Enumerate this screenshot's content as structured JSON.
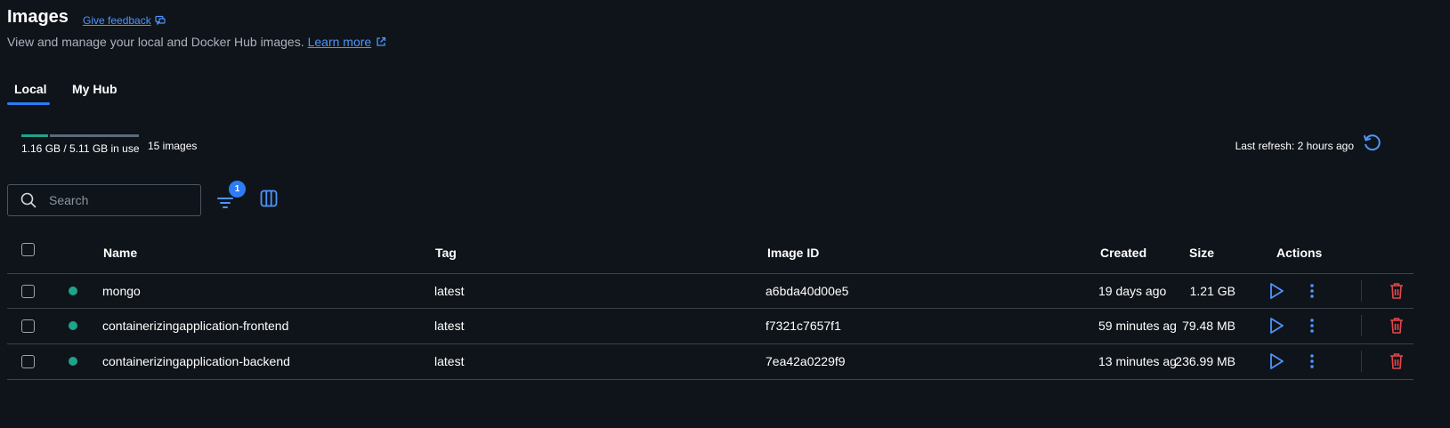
{
  "header": {
    "title": "Images",
    "feedback_label": "Give feedback",
    "subtitle": "View and manage your local and Docker Hub images.",
    "learn_more": "Learn more"
  },
  "tabs": [
    {
      "label": "Local",
      "active": true
    },
    {
      "label": "My Hub",
      "active": false
    }
  ],
  "usage": {
    "text": "1.16 GB / 5.11 GB in use",
    "used_fraction": 0.227,
    "count_text": "15 images",
    "refresh_text": "Last refresh: 2 hours ago"
  },
  "search": {
    "placeholder": "Search",
    "value": ""
  },
  "filter": {
    "badge": "1"
  },
  "table": {
    "headers": {
      "name": "Name",
      "tag": "Tag",
      "image_id": "Image ID",
      "created": "Created",
      "size": "Size",
      "actions": "Actions"
    },
    "rows": [
      {
        "name": "mongo",
        "tag": "latest",
        "image_id": "a6bda40d00e5",
        "created": "19 days ago",
        "size": "1.21 GB"
      },
      {
        "name": "containerizingapplication-frontend",
        "tag": "latest",
        "image_id": "f7321c7657f1",
        "created": "59 minutes ag",
        "size": "79.48 MB"
      },
      {
        "name": "containerizingapplication-backend",
        "tag": "latest",
        "image_id": "7ea42a0229f9",
        "created": "13 minutes ag",
        "size": "236.99 MB"
      }
    ]
  },
  "colors": {
    "accent": "#2d7cf6",
    "in_use": "#1fa38a",
    "delete": "#e5484d",
    "background": "#0f141a"
  },
  "icons": [
    "chat-icon",
    "external-link-icon",
    "refresh-icon",
    "search-icon",
    "filter-icon",
    "columns-icon",
    "run-icon",
    "more-icon",
    "trash-icon"
  ]
}
